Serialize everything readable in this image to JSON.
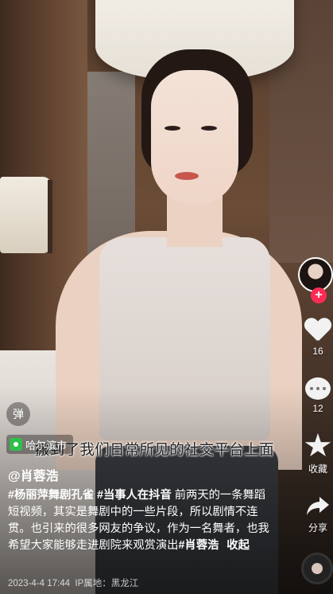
{
  "subtitle": "搬到了我们日常所见的社交平台上面",
  "danmu_label": "弹",
  "location": "哈尔滨市",
  "author": "@肖蓉浩",
  "caption": {
    "tag1": "#杨丽萍舞剧孔雀",
    "tag2": "#当事人在抖音",
    "text": "前两天的一条舞蹈短视频，其实是舞剧中的一些片段，所以剧情不连贯。也引来的很多网友的争议，作为一名舞者，也我希望大家能够走进剧院来观赏演出",
    "tag3": "#肖蓉浩",
    "more": "收起"
  },
  "meta": {
    "datetime": "2023-4-4 17:44",
    "ip": "IP属地：黑龙江"
  },
  "rail": {
    "likes": "16",
    "comments": "12",
    "favorite_label": "收藏",
    "share_label": "分享",
    "follow_symbol": "+"
  },
  "icons": [
    "location-pin-icon",
    "heart-icon",
    "comment-icon",
    "star-icon",
    "share-icon",
    "music-disc-icon"
  ],
  "colors": {
    "follow": "#fe2c55",
    "pin": "#2fbf4a"
  }
}
